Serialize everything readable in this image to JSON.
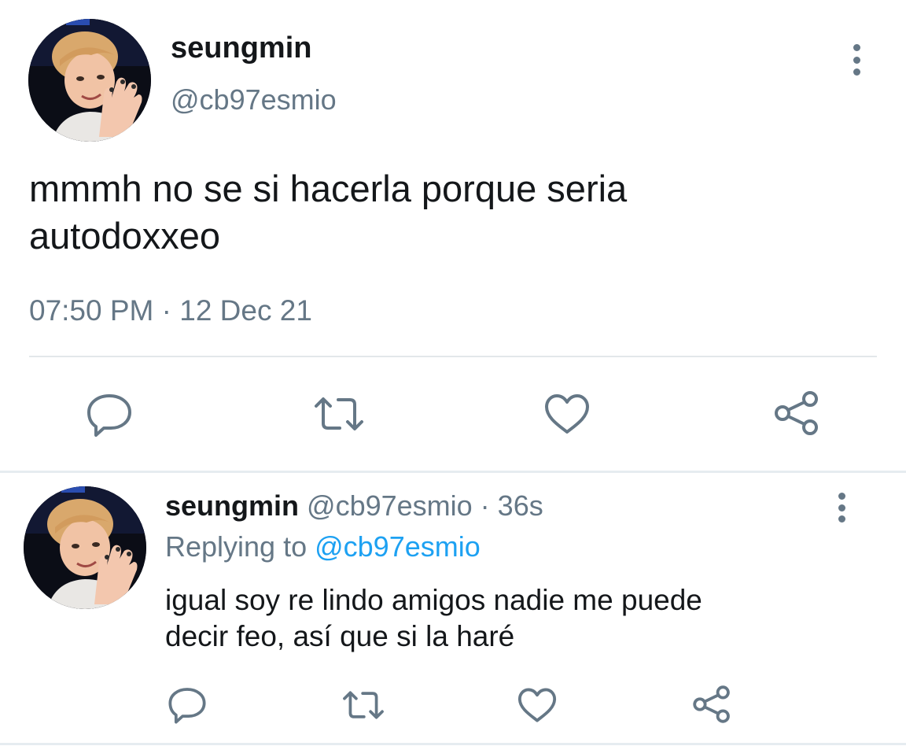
{
  "main_tweet": {
    "display_name": "seungmin",
    "handle": "@cb97esmio",
    "text_lines": [
      "mmmh no se si hacerla porque seria",
      "autodoxxeo"
    ],
    "timestamp": "07:50 PM · 12 Dec 21",
    "avatar_icon": "profile-photo",
    "more_icon": "more-vertical-icon"
  },
  "actions": {
    "reply_icon": "reply-icon",
    "retweet_icon": "retweet-icon",
    "like_icon": "heart-icon",
    "share_icon": "share-icon"
  },
  "reply_tweet": {
    "display_name": "seungmin",
    "handle": "@cb97esmio",
    "separator": " · ",
    "time_ago": "36s",
    "replying_prefix": "Replying to ",
    "replying_to": "@cb97esmio",
    "text_lines": [
      "igual soy re lindo amigos nadie me puede",
      "decir feo, así que si la haré"
    ],
    "avatar_icon": "profile-photo",
    "more_icon": "more-vertical-icon"
  },
  "colors": {
    "primary_text": "#14171a",
    "secondary_text": "#657786",
    "link": "#1da1f2",
    "divider": "#e6ecf0"
  }
}
